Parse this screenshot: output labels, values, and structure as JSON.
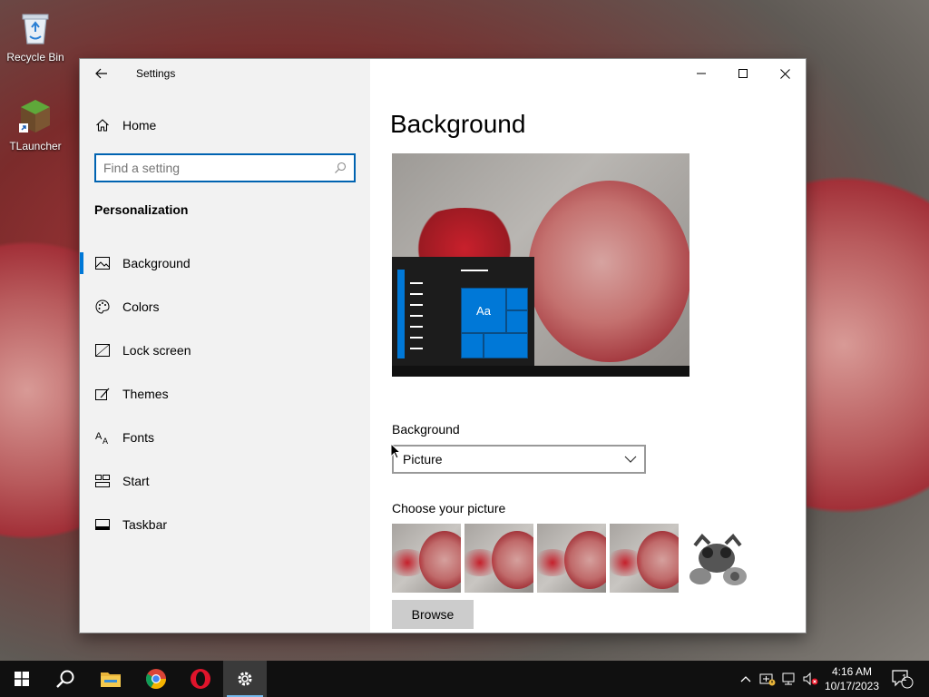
{
  "desktop": {
    "icons": [
      {
        "label": "Recycle Bin",
        "icon": "recycle-bin-icon"
      },
      {
        "label": "TLauncher",
        "icon": "tlauncher-icon"
      }
    ]
  },
  "window": {
    "app_title": "Settings",
    "controls": [
      "minimize-icon",
      "maximize-icon",
      "close-icon"
    ]
  },
  "nav": {
    "home_label": "Home",
    "search_placeholder": "Find a setting",
    "section_title": "Personalization",
    "items": [
      {
        "label": "Background",
        "icon": "picture-icon",
        "active": true
      },
      {
        "label": "Colors",
        "icon": "palette-icon",
        "active": false
      },
      {
        "label": "Lock screen",
        "icon": "lock-screen-icon",
        "active": false
      },
      {
        "label": "Themes",
        "icon": "themes-icon",
        "active": false
      },
      {
        "label": "Fonts",
        "icon": "fonts-icon",
        "active": false
      },
      {
        "label": "Start",
        "icon": "start-icon",
        "active": false
      },
      {
        "label": "Taskbar",
        "icon": "taskbar-icon",
        "active": false
      }
    ]
  },
  "content": {
    "page_title": "Background",
    "preview_tile_text": "Aa",
    "background_label": "Background",
    "background_value": "Picture",
    "choose_label": "Choose your picture",
    "browse_label": "Browse"
  },
  "taskbar": {
    "apps": [
      "windows-start-icon",
      "search-icon",
      "file-explorer-icon",
      "chrome-icon",
      "opera-icon",
      "settings-icon"
    ],
    "clock_time": "4:16 AM",
    "clock_date": "10/17/2023",
    "notification_count": "1"
  },
  "colors": {
    "accent": "#0078d7",
    "nav_bg": "#f2f2f2",
    "taskbar_bg": "#101010"
  }
}
